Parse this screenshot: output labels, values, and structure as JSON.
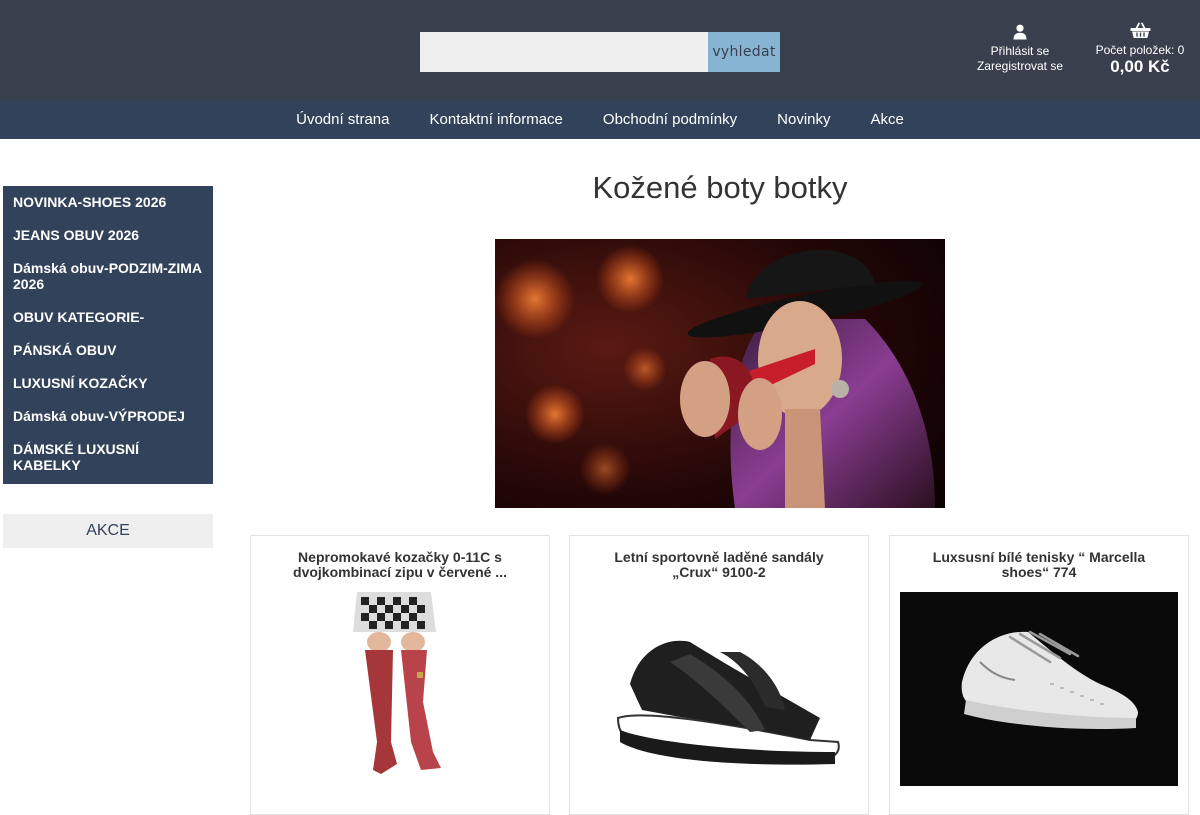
{
  "search": {
    "placeholder": "",
    "value": "",
    "button_label": "vyhledat"
  },
  "account": {
    "login_label": "Přihlásit se",
    "register_label": "Zaregistrovat se",
    "icon": "user-icon"
  },
  "cart": {
    "count_label": "Počet položek: 0",
    "total": "0,00 Kč",
    "icon": "basket-icon"
  },
  "nav": {
    "items": [
      "Úvodní strana",
      "Kontaktní informace",
      "Obchodní podmínky",
      "Novinky",
      "Akce"
    ]
  },
  "sidebar": {
    "items": [
      "NOVINKA-SHOES 2026",
      "JEANS OBUV 2026",
      "Dámská obuv-PODZIM-ZIMA 2026",
      "OBUV KATEGORIE-",
      "PÁNSKÁ OBUV",
      "LUXUSNÍ KOZAČKY",
      "Dámská obuv-VÝPRODEJ",
      "DÁMSKÉ LUXUSNÍ KABELKY"
    ],
    "akce_label": "AKCE"
  },
  "main": {
    "title": "Kožené boty botky",
    "products": [
      {
        "title": "Nepromokavé kozačky 0-11C s dvojkombinací zipu v červené ..."
      },
      {
        "title": "Letní sportovně laděné sandály „Crux“ 9100-2"
      },
      {
        "title": "Luxsusní bílé tenisky “ Marcella shoes“ 774"
      }
    ]
  },
  "colors": {
    "header_bg": "#3a3f4e",
    "nav_bg": "#33425b",
    "search_button": "#88b4d4",
    "search_field": "#efefef"
  }
}
